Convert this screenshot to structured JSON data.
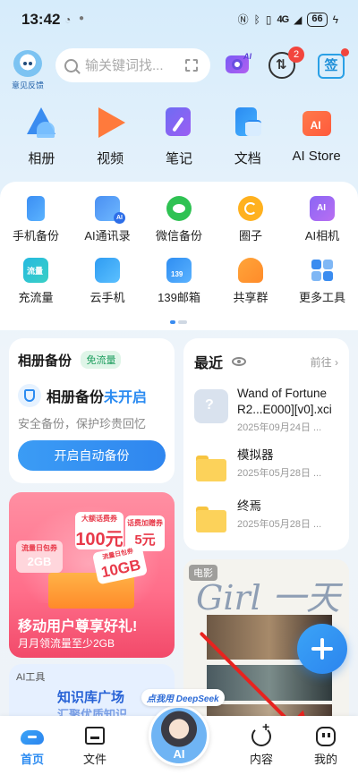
{
  "status_bar": {
    "time": "13:42",
    "signal": "4G",
    "battery": "66"
  },
  "header": {
    "feedback_label": "意见反馈",
    "search_placeholder": "输关键词找...",
    "camera_ai_label": "AI",
    "sync_badge": "2",
    "sign_label": "签"
  },
  "apps": [
    {
      "label": "相册",
      "icon": "photos-icon"
    },
    {
      "label": "视频",
      "icon": "video-icon"
    },
    {
      "label": "笔记",
      "icon": "notes-icon"
    },
    {
      "label": "文档",
      "icon": "documents-icon"
    },
    {
      "label": "AI Store",
      "icon": "ai-store-icon"
    }
  ],
  "tools": [
    {
      "label": "手机备份",
      "icon": "phone-backup-icon"
    },
    {
      "label": "AI通讯录",
      "icon": "ai-contacts-icon"
    },
    {
      "label": "微信备份",
      "icon": "wechat-backup-icon"
    },
    {
      "label": "圈子",
      "icon": "circle-icon"
    },
    {
      "label": "AI相机",
      "icon": "ai-camera-icon"
    },
    {
      "label": "充流量",
      "icon": "data-topup-icon"
    },
    {
      "label": "云手机",
      "icon": "cloud-phone-icon"
    },
    {
      "label": "139邮箱",
      "icon": "mail-139-icon"
    },
    {
      "label": "共享群",
      "icon": "share-group-icon"
    },
    {
      "label": "更多工具",
      "icon": "more-tools-icon"
    }
  ],
  "backup_card": {
    "title": "相册备份",
    "tag": "免流量",
    "status_prefix": "相册备份",
    "status_value": "未开启",
    "description": "安全备份，保护珍贵回忆",
    "button": "开启自动备份"
  },
  "recent_card": {
    "title": "最近",
    "more": "前往",
    "files": [
      {
        "name": "Wand of Fortune R2...E000][v0].xci",
        "date": "2025年09月24日 ...",
        "type": "unknown"
      },
      {
        "name": "模拟器",
        "date": "2025年05月28日 ...",
        "type": "folder"
      },
      {
        "name": "终焉",
        "date": "2025年05月28日 ...",
        "type": "folder"
      }
    ]
  },
  "promo": {
    "chip1_label": "大额话费券",
    "chip1_value": "100元",
    "chip2_label": "话费加赠券",
    "chip2_value": "5元",
    "chip3_label": "流量日包券",
    "chip3_value": "10GB",
    "chip4_label": "流量日包券",
    "chip4_value": "2GB",
    "title": "移动用户尊享好礼!",
    "subtitle": "月月领流量至少2GB"
  },
  "ai_tool_card": {
    "tag": "AI工具",
    "title": "知识库广场",
    "subtitle": "汇聚优质知识"
  },
  "movie_card": {
    "tag": "电影",
    "script": "Girl 一天"
  },
  "bottom_nav": {
    "home": "首页",
    "files": "文件",
    "ai_bubble": "点我用 DeepSeek",
    "ai": "AI",
    "content": "内容",
    "me": "我的"
  }
}
